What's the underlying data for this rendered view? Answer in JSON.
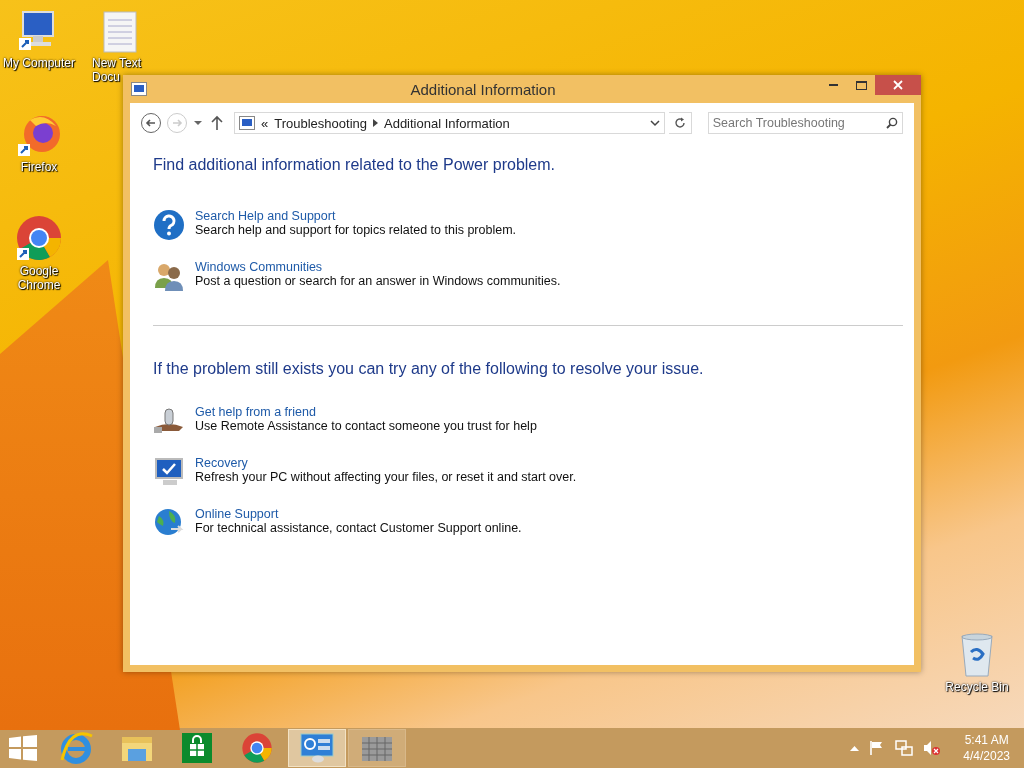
{
  "desktop_icons": [
    {
      "kind": "computer",
      "label": "My Computer"
    },
    {
      "kind": "text",
      "label": "New Text Docu"
    },
    {
      "kind": "firefox",
      "label": "Firefox"
    },
    {
      "kind": "chrome",
      "label": "Google Chrome"
    },
    {
      "kind": "recycle",
      "label": "Recycle Bin"
    }
  ],
  "window": {
    "title": "Additional Information",
    "nav": {
      "back": {
        "disabled": false
      },
      "forward": {
        "disabled": true
      }
    },
    "address": {
      "overflow": "«",
      "crumbs": [
        "Troubleshooting",
        "Additional Information"
      ]
    },
    "search": {
      "placeholder": "Search Troubleshooting"
    },
    "sections": [
      {
        "heading": "Find additional information related to the Power problem.",
        "items": [
          {
            "kind": "help",
            "title": "Search Help and Support",
            "description": "Search help and support for topics related to this problem."
          },
          {
            "kind": "people",
            "title": "Windows Communities",
            "description": "Post a question or search for an answer in Windows communities."
          }
        ]
      },
      {
        "heading": "If the problem still exists you can try any of the following to resolve your issue.",
        "items": [
          {
            "kind": "remote",
            "title": "Get help from a friend",
            "description": "Use Remote Assistance to contact someone you trust for help"
          },
          {
            "kind": "recovery",
            "title": "Recovery",
            "description": "Refresh your PC without affecting your files, or reset it and start over."
          },
          {
            "kind": "globe",
            "title": "Online Support",
            "description": "For technical assistance, contact Customer Support online."
          }
        ]
      }
    ]
  },
  "taskbar": {
    "apps": [
      {
        "kind": "start",
        "selected": false,
        "running": false
      },
      {
        "kind": "ie",
        "selected": false,
        "running": false
      },
      {
        "kind": "explorer",
        "selected": false,
        "running": false
      },
      {
        "kind": "store",
        "selected": false,
        "running": false
      },
      {
        "kind": "chrome",
        "selected": false,
        "running": false
      },
      {
        "kind": "control",
        "selected": true,
        "running": true
      },
      {
        "kind": "firewall",
        "selected": false,
        "running": true
      }
    ],
    "clock": {
      "time": "5:41 AM",
      "date": "4/4/2023"
    }
  }
}
